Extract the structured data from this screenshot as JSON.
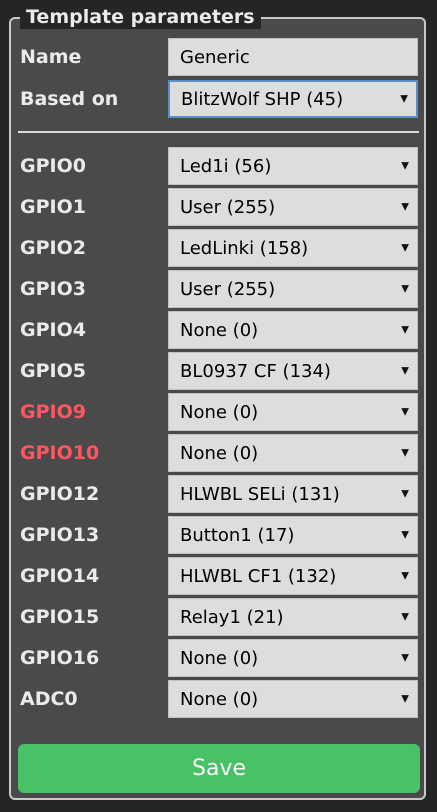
{
  "title": "Template parameters",
  "name_field": {
    "label": "Name",
    "value": "Generic"
  },
  "based_on": {
    "label": "Based on",
    "value": "BlitzWolf SHP (45)"
  },
  "gpios": [
    {
      "label": "GPIO0",
      "value": "Led1i (56)"
    },
    {
      "label": "GPIO1",
      "value": "User (255)"
    },
    {
      "label": "GPIO2",
      "value": "LedLinki (158)"
    },
    {
      "label": "GPIO3",
      "value": "User (255)"
    },
    {
      "label": "GPIO4",
      "value": "None (0)"
    },
    {
      "label": "GPIO5",
      "value": "BL0937 CF (134)"
    },
    {
      "label": "GPIO9",
      "value": "None (0)"
    },
    {
      "label": "GPIO10",
      "value": "None (0)"
    },
    {
      "label": "GPIO12",
      "value": "HLWBL SELi (131)"
    },
    {
      "label": "GPIO13",
      "value": "Button1 (17)"
    },
    {
      "label": "GPIO14",
      "value": "HLWBL CF1 (132)"
    },
    {
      "label": "GPIO15",
      "value": "Relay1 (21)"
    },
    {
      "label": "GPIO16",
      "value": "None (0)"
    },
    {
      "label": "ADC0",
      "value": "None (0)"
    }
  ],
  "save_label": "Save",
  "colors": {
    "warning_label": "#ff5661",
    "save_button": "#47c266",
    "panel": "#4a4a4a"
  }
}
